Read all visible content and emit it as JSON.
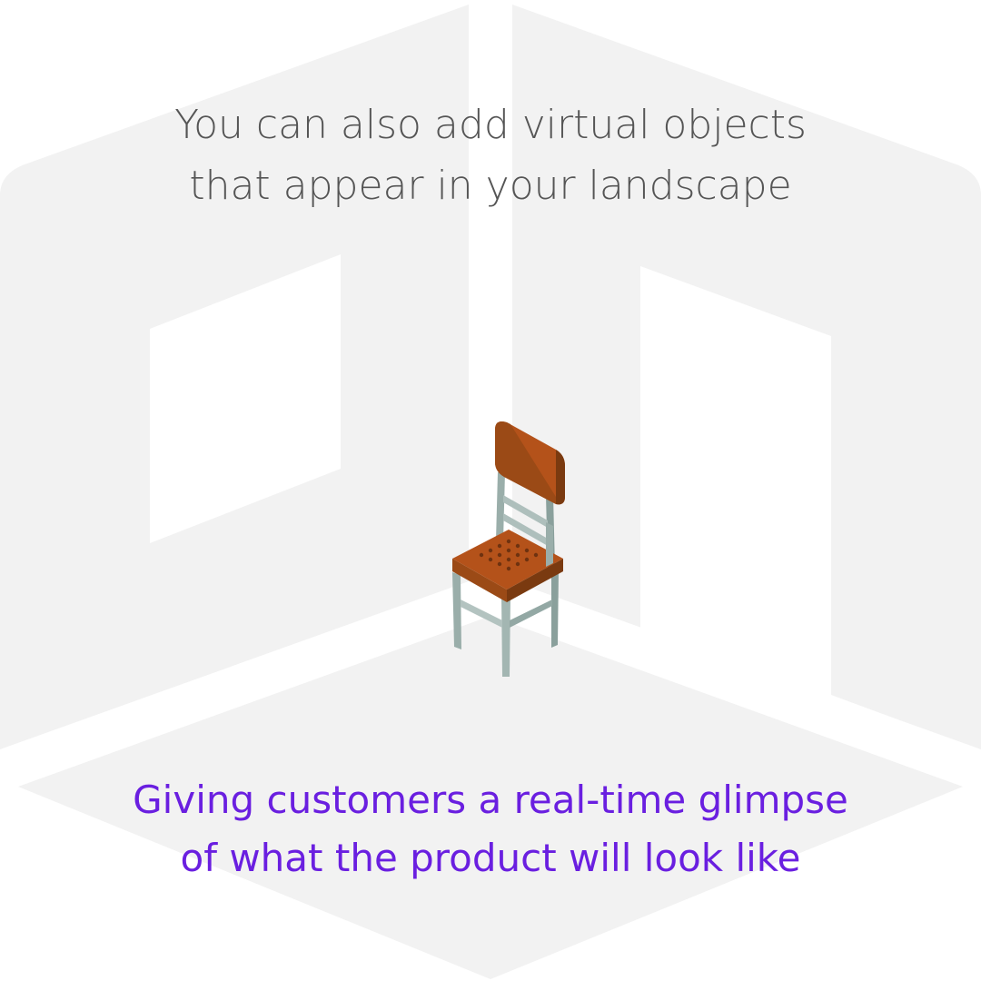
{
  "headline": {
    "line1": "You can also add virtual objects",
    "line2": "that appear in your landscape",
    "color": "#555555"
  },
  "tagline": {
    "line1": "Giving customers a real-time glimpse",
    "line2": "of what the product will look like",
    "color": "#6a1fe0"
  },
  "illustration": {
    "object": "chair-icon",
    "room_color": "#f2f2f2",
    "seat_color": "#b4521a",
    "backrest_color": "#9b4a16",
    "leg_color": "#9aaeaa"
  }
}
